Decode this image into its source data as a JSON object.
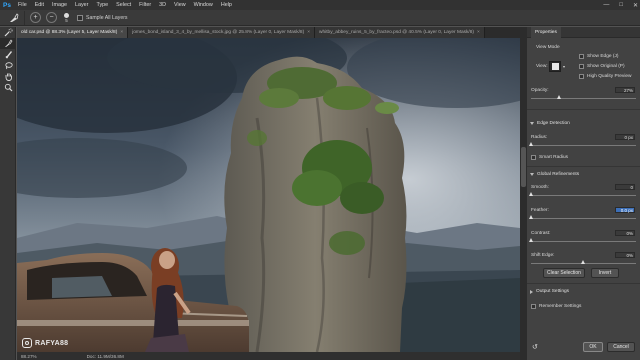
{
  "app": {
    "logo": "Ps",
    "menu": [
      "File",
      "Edit",
      "Image",
      "Layer",
      "Type",
      "Select",
      "Filter",
      "3D",
      "View",
      "Window",
      "Help"
    ],
    "window_controls": [
      "—",
      "□",
      "✕"
    ]
  },
  "options_bar": {
    "tool_icon": "refine-brush-icon",
    "brush_size": "5",
    "sample_label": "Sample All Layers"
  },
  "tabs": [
    {
      "label": "old car.psd @ 88.3% (Layer 5, Layer Mask/8)",
      "active": true
    },
    {
      "label": "jomes_bond_island_3_4_by_mellisa_stock.jpg @ 25.8% (Layer 0, Layer Mask/8)",
      "active": false
    },
    {
      "label": "whitby_abbey_ruins_5_by_fracteo.psd @ 40.5% (Layer 0, Layer Mask/8)",
      "active": false
    }
  ],
  "tools": [
    "quick-selection-icon",
    "refine-brush-icon",
    "brush-icon",
    "lasso-icon",
    "hand-icon",
    "zoom-icon"
  ],
  "status_bar": {
    "zoom": "88.27%",
    "doc": "Doc: 11.9M/36.8M"
  },
  "watermark": "RAFYA88",
  "properties": {
    "title": "Properties",
    "view_mode_label": "View Mode",
    "view_label": "View:",
    "show_edge_label": "Show Edge (J)",
    "show_original_label": "Show Original (P)",
    "high_quality_label": "High Quality Preview",
    "opacity_label": "Opacity:",
    "opacity_value": "27%",
    "opacity_level": 0.27,
    "edge_detection_label": "Edge Detection",
    "radius_label": "Radius:",
    "radius_value": "0 px",
    "radius_level": 0.0,
    "smart_radius_label": "Smart Radius",
    "global_refinements_label": "Global Refinements",
    "smooth_label": "Smooth:",
    "smooth_value": "0",
    "smooth_level": 0.0,
    "feather_label": "Feather:",
    "feather_value": "0.0 px",
    "feather_level": 0.0,
    "contrast_label": "Contrast:",
    "contrast_value": "0%",
    "contrast_level": 0.0,
    "shift_edge_label": "Shift Edge:",
    "shift_edge_value": "0%",
    "shift_edge_level": 0.5,
    "clear_selection_label": "Clear Selection",
    "invert_label": "Invert",
    "output_settings_label": "Output Settings",
    "remember_settings_label": "Remember Settings",
    "ok_label": "OK",
    "cancel_label": "Cancel"
  }
}
